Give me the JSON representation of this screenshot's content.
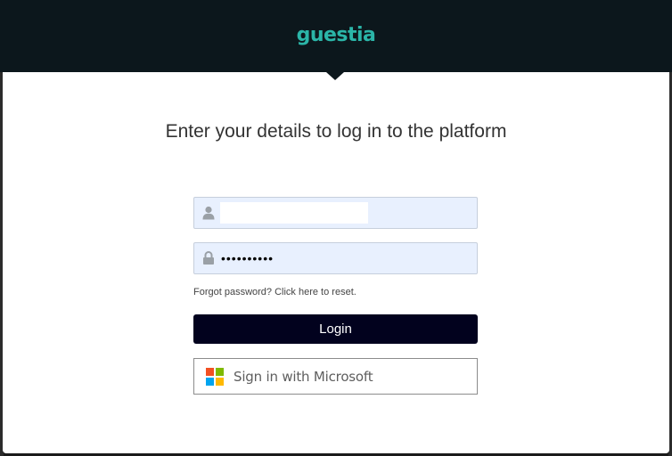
{
  "brand": {
    "logo_text": "guestia",
    "logo_color": "#2bb5a8",
    "header_color": "#0c171c"
  },
  "login": {
    "heading": "Enter your details to log in to the platform",
    "username": {
      "value": "",
      "icon": "user-icon"
    },
    "password": {
      "value": "••••••••••",
      "icon": "lock-icon"
    },
    "forgot_text": "Forgot password? Click here to reset.",
    "login_label": "Login",
    "login_color": "#02021e",
    "microsoft_label": "Sign in with Microsoft",
    "microsoft_colors": [
      "#f25022",
      "#7fba00",
      "#00a4ef",
      "#ffb900"
    ]
  }
}
